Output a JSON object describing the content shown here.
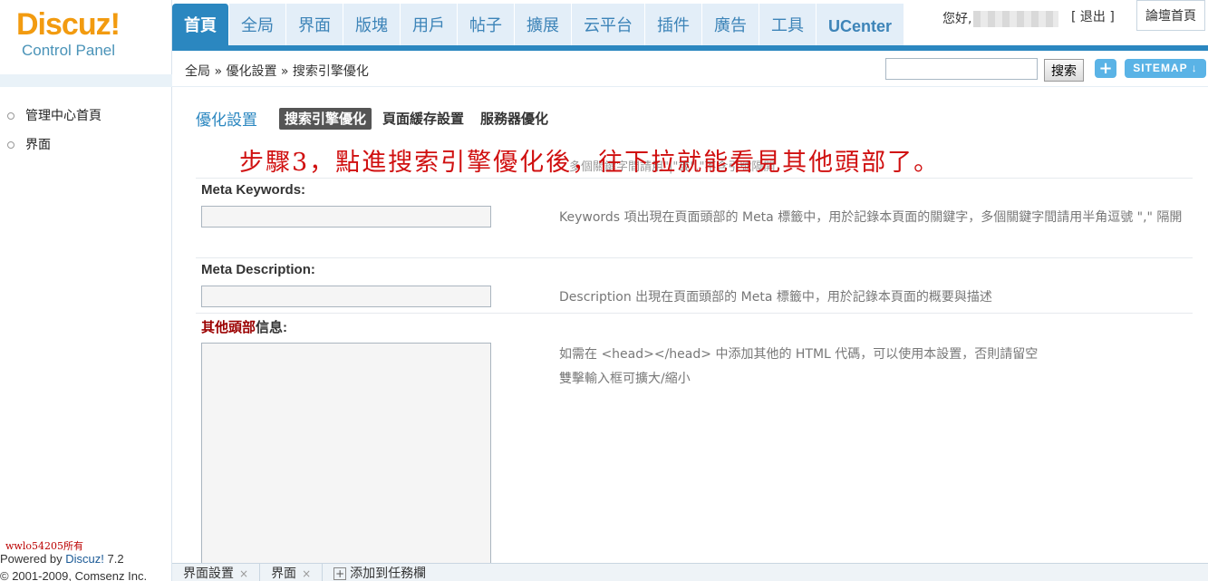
{
  "logo": {
    "brand": "Discuz!",
    "subtitle": "Control Panel"
  },
  "topnav": {
    "tabs": [
      {
        "label": "首頁",
        "active": true
      },
      {
        "label": "全局"
      },
      {
        "label": "界面"
      },
      {
        "label": "版塊"
      },
      {
        "label": "用戶"
      },
      {
        "label": "帖子"
      },
      {
        "label": "擴展"
      },
      {
        "label": "云平台"
      },
      {
        "label": "插件"
      },
      {
        "label": "廣告"
      },
      {
        "label": "工具"
      },
      {
        "label": "UCenter"
      }
    ],
    "greeting": "您好,",
    "logout": "[ 退出 ]",
    "forum_home": "論壇首頁"
  },
  "crumbbar": {
    "breadcrumb": "全局 » 優化設置 » 搜索引擎優化",
    "search_button": "搜索",
    "add_button": "+",
    "sitemap_button": "SITEMAP ↓"
  },
  "sidebar": {
    "items": [
      {
        "label": "管理中心首頁"
      },
      {
        "label": "界面"
      }
    ],
    "watermark": "wwlo54205所有",
    "powered_prefix": "Powered by ",
    "powered_brand": "Discuz!",
    "powered_version": " 7.2",
    "copyright": "© 2001-2009, Comsenz Inc."
  },
  "main": {
    "title": "優化設置",
    "subtabs": [
      {
        "label": "搜索引擎優化",
        "active": true
      },
      {
        "label": "頁面緩存設置"
      },
      {
        "label": "服務器優化"
      }
    ],
    "hidden_hint": "多個關鍵字間請用\"|\"或\",\"不含引號隔開",
    "annotation": "步驟3，點進搜索引擎優化後，往下拉就能看見其他頭部了。",
    "fields": {
      "keywords": {
        "label": "Meta Keywords:",
        "value": "",
        "hint": "Keywords 項出現在頁面頭部的 Meta 標籤中，用於記錄本頁面的關鍵字，多個關鍵字間請用半角逗號 \",\" 隔開"
      },
      "description": {
        "label": "Meta Description:",
        "value": "",
        "hint": "Description 出現在頁面頭部的 Meta 標籤中，用於記錄本頁面的概要與描述"
      },
      "other_head": {
        "label_em": "其他頭部",
        "label_rest": "信息:",
        "hint_line1": "如需在 <head></head> 中添加其他的 HTML 代碼，可以使用本設置，否則請留空",
        "hint_line2": "雙擊輸入框可擴大/縮小"
      }
    }
  },
  "taskbar": {
    "items": [
      {
        "label": "界面設置",
        "close": "×"
      },
      {
        "label": "界面",
        "close": "×"
      }
    ],
    "add_task_icon": "+",
    "add_task": "添加到任務欄"
  },
  "colors": {
    "accent": "#2b87c0",
    "brand_orange": "#f29b10",
    "annotation_red": "#d01010"
  }
}
